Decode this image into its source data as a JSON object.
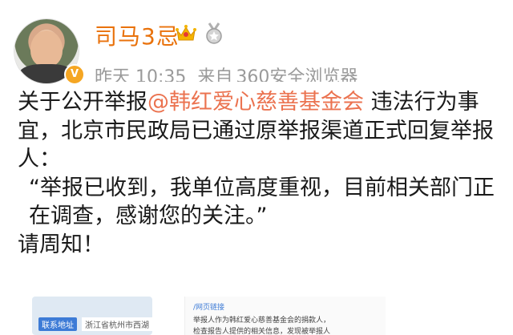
{
  "author": {
    "username": "司马3忌",
    "crown_icon": "crown-icon",
    "medal_icon": "medal-icon",
    "verify_badge": "V"
  },
  "meta": {
    "time": "昨天 10:35",
    "source_prefix": "来自",
    "source": "360安全浏览器"
  },
  "post": {
    "line1_before": "关于公开举报",
    "mention": "@韩红爱心慈善基金会",
    "line1_after": " 违法行为事宜，北京市民政局已通过原举报渠道正式回复举报人：",
    "quote": "“举报已收到，我单位高度重视，目前相关部门正在调查，感谢您的关注。”",
    "closing": "请周知！"
  },
  "preview": {
    "addr_label": "联系地址",
    "addr_value": "浙江省杭州市西湖",
    "doc_link": "/网页链接",
    "doc_line1": "举报人作为韩红爱心慈善基金会的捐款人，",
    "doc_line2": "检查报告人提供的相关信息，发现被举报人"
  },
  "colors": {
    "username": "#e9720c",
    "mention": "#eb7350",
    "meta": "#9a9a9a"
  }
}
